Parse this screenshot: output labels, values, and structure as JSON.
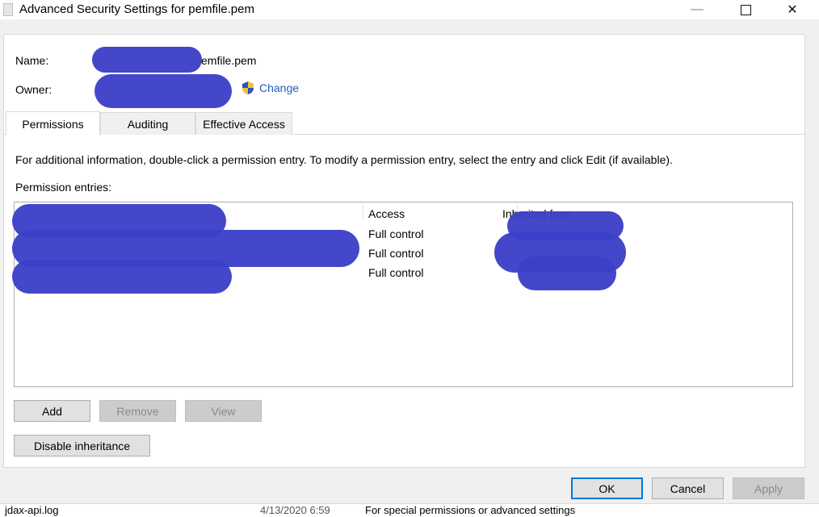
{
  "window": {
    "title": "Advanced Security Settings for pemfile.pem",
    "controls": {
      "minimize": "—",
      "close": "✕"
    }
  },
  "header": {
    "name_label": "Name:",
    "name_value_visible": "emfile.pem",
    "owner_label": "Owner:",
    "change_label": "Change"
  },
  "tabs": [
    {
      "label": "Permissions",
      "active": true
    },
    {
      "label": "Auditing",
      "active": false
    },
    {
      "label": "Effective Access",
      "active": false
    }
  ],
  "permissions": {
    "info_text": "For additional information, double-click a permission entry. To modify a permission entry, select the entry and click Edit (if available).",
    "entries_label": "Permission entries:",
    "columns": {
      "access": "Access",
      "inherited_from": "Inherited from"
    },
    "rows": [
      {
        "access": "Full control"
      },
      {
        "access": "Full control"
      },
      {
        "access": "Full control"
      }
    ]
  },
  "buttons": {
    "add": "Add",
    "remove": "Remove",
    "view": "View",
    "disable_inheritance": "Disable inheritance",
    "ok": "OK",
    "cancel": "Cancel",
    "apply": "Apply"
  },
  "background_window": {
    "file_name": "jdax-api.log",
    "date": "4/13/2020 6:59",
    "text": "For special permissions or advanced settings"
  },
  "colors": {
    "redaction": "#3c3fc8",
    "link": "#1f5fbf",
    "focus_border": "#0078d7"
  }
}
